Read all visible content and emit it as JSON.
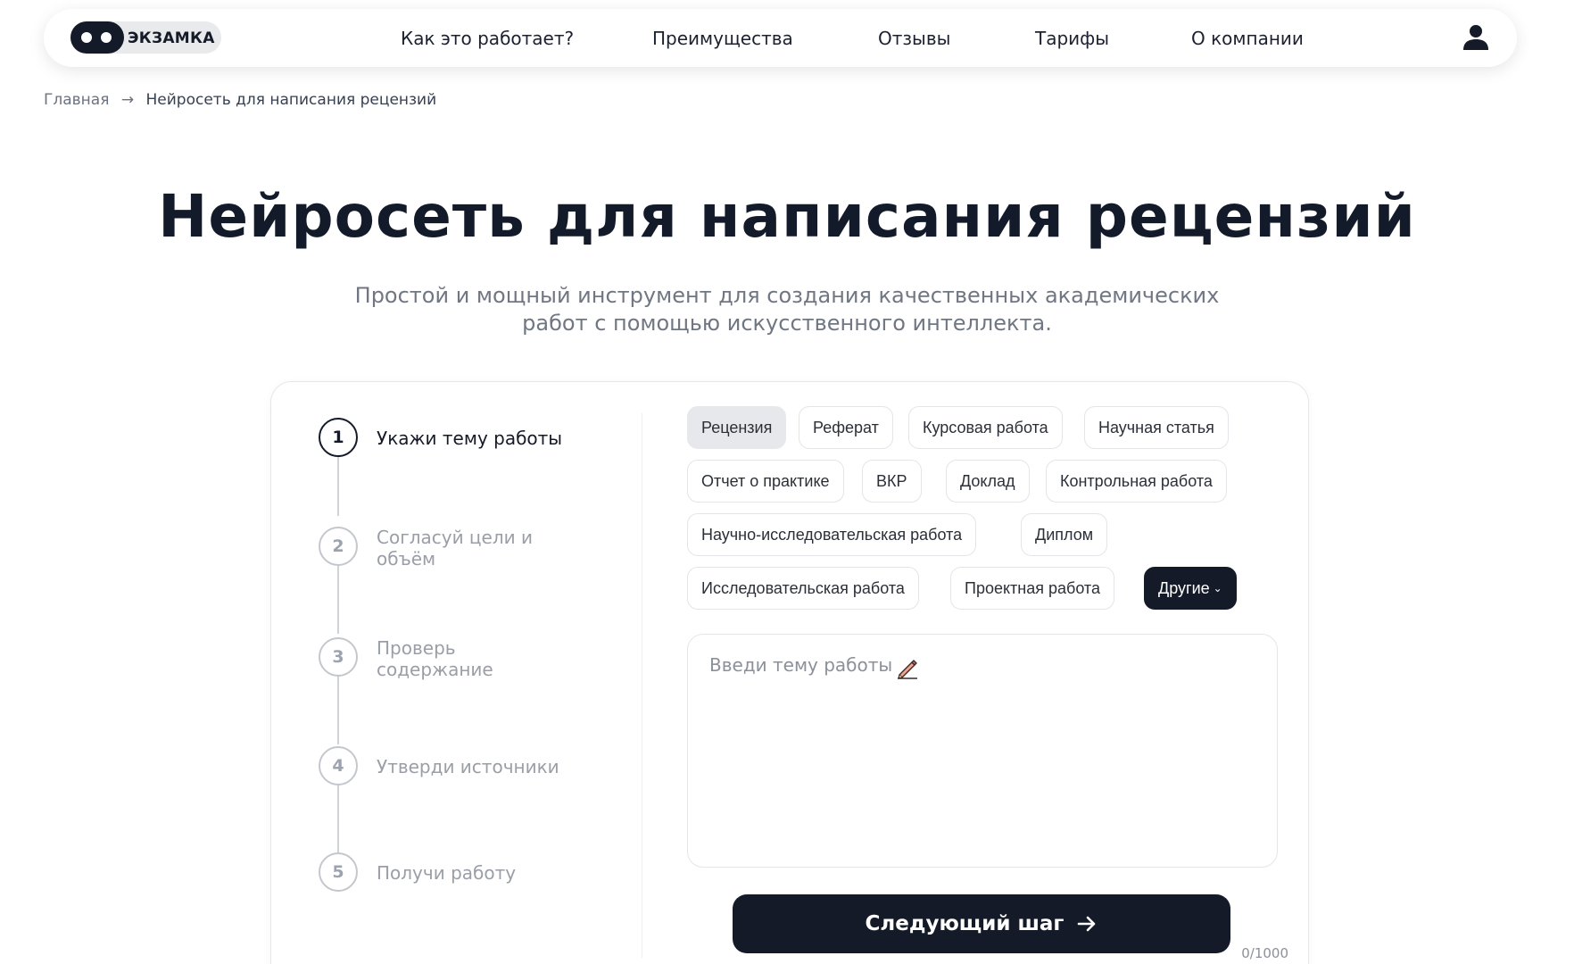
{
  "header": {
    "logo_text": "ЭКЗАМКА",
    "nav": [
      {
        "label": "Как это работает?"
      },
      {
        "label": "Преимущества"
      },
      {
        "label": "Отзывы"
      },
      {
        "label": "Тарифы"
      },
      {
        "label": "О компании"
      }
    ],
    "user_icon": "user-icon"
  },
  "breadcrumb": {
    "home": "Главная",
    "separator": "→",
    "current": "Нейросеть для написания рецензий"
  },
  "hero": {
    "title": "Нейросеть для написания рецензий",
    "subtitle": "Простой и мощный инструмент для создания качественных академических работ с помощью искусственного интеллекта."
  },
  "steps": [
    {
      "number": "1",
      "label": "Укажи тему работы",
      "active": true
    },
    {
      "number": "2",
      "label": "Согласуй цели и объём",
      "active": false
    },
    {
      "number": "3",
      "label": "Проверь содержание",
      "active": false
    },
    {
      "number": "4",
      "label": "Утверди источники",
      "active": false
    },
    {
      "number": "5",
      "label": "Получи работу",
      "active": false
    }
  ],
  "work_types": [
    {
      "label": "Рецензия",
      "selected": true
    },
    {
      "label": "Реферат"
    },
    {
      "label": "Курсовая работа"
    },
    {
      "label": "Научная статья"
    },
    {
      "label": "Отчет о практике"
    },
    {
      "label": "ВКР"
    },
    {
      "label": "Доклад"
    },
    {
      "label": "Контрольная работа"
    },
    {
      "label": "Научно-исследовательская работа"
    },
    {
      "label": "Диплом"
    },
    {
      "label": "Исследовательская работа"
    },
    {
      "label": "Проектная работа"
    },
    {
      "label": "Другие",
      "dropdown": true
    }
  ],
  "topic_input": {
    "placeholder": "Введи тему работы",
    "value": "",
    "icon": "pencil-icon",
    "counter": "0/1000"
  },
  "next_button": {
    "label": "Следующий шаг",
    "icon": "arrow-right-icon"
  },
  "colors": {
    "accent_dark": "#141a28",
    "chip_selected_bg": "#e7e8eb",
    "muted_text": "#707783"
  }
}
